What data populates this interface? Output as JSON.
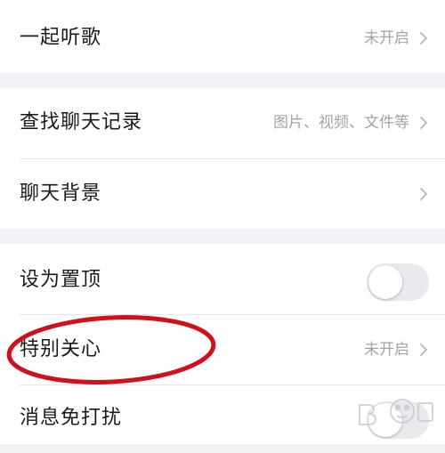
{
  "settings": {
    "rows": [
      {
        "label": "一起听歌",
        "value": "未开启"
      },
      {
        "label": "查找聊天记录",
        "value": "图片、视频、文件等"
      },
      {
        "label": "聊天背景",
        "value": ""
      },
      {
        "label": "设为置顶",
        "toggle": false
      },
      {
        "label": "特别关心",
        "value": "未开启"
      },
      {
        "label": "消息免打扰",
        "toggle": false
      }
    ]
  },
  "colors": {
    "background": "#f2f2f6",
    "highlight": "#d0101a",
    "label": "#1a1a1a",
    "secondary": "#a3a3a8"
  },
  "icons": {
    "chevron": "chevron-right-icon",
    "watermark": "baidu-jingyan-watermark"
  }
}
